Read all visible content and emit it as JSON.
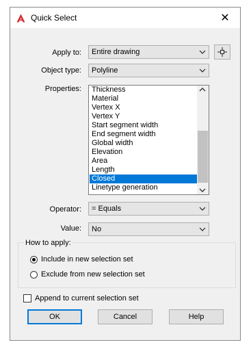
{
  "window": {
    "title": "Quick Select",
    "close_symbol": "✕"
  },
  "form": {
    "apply_to": {
      "label": "Apply to:",
      "value": "Entire drawing"
    },
    "object_type": {
      "label": "Object type:",
      "value": "Polyline"
    },
    "properties": {
      "label": "Properties:",
      "items": [
        "Thickness",
        "Material",
        "Vertex X",
        "Vertex Y",
        "Start segment width",
        "End segment width",
        "Global width",
        "Elevation",
        "Area",
        "Length",
        "Closed",
        "Linetype generation"
      ],
      "selected": "Closed"
    },
    "operator": {
      "label": "Operator:",
      "value": "= Equals"
    },
    "value": {
      "label": "Value:",
      "value": "No"
    }
  },
  "how_to_apply": {
    "title": "How to apply:",
    "options": [
      {
        "label": "Include in new selection set",
        "selected": true
      },
      {
        "label": "Exclude from new selection set",
        "selected": false
      }
    ]
  },
  "append": {
    "label": "Append to current selection set",
    "checked": false
  },
  "buttons": {
    "ok": "OK",
    "cancel": "Cancel",
    "help": "Help"
  },
  "colors": {
    "accent": "#0078d7",
    "app_icon": "#d32f2f"
  }
}
